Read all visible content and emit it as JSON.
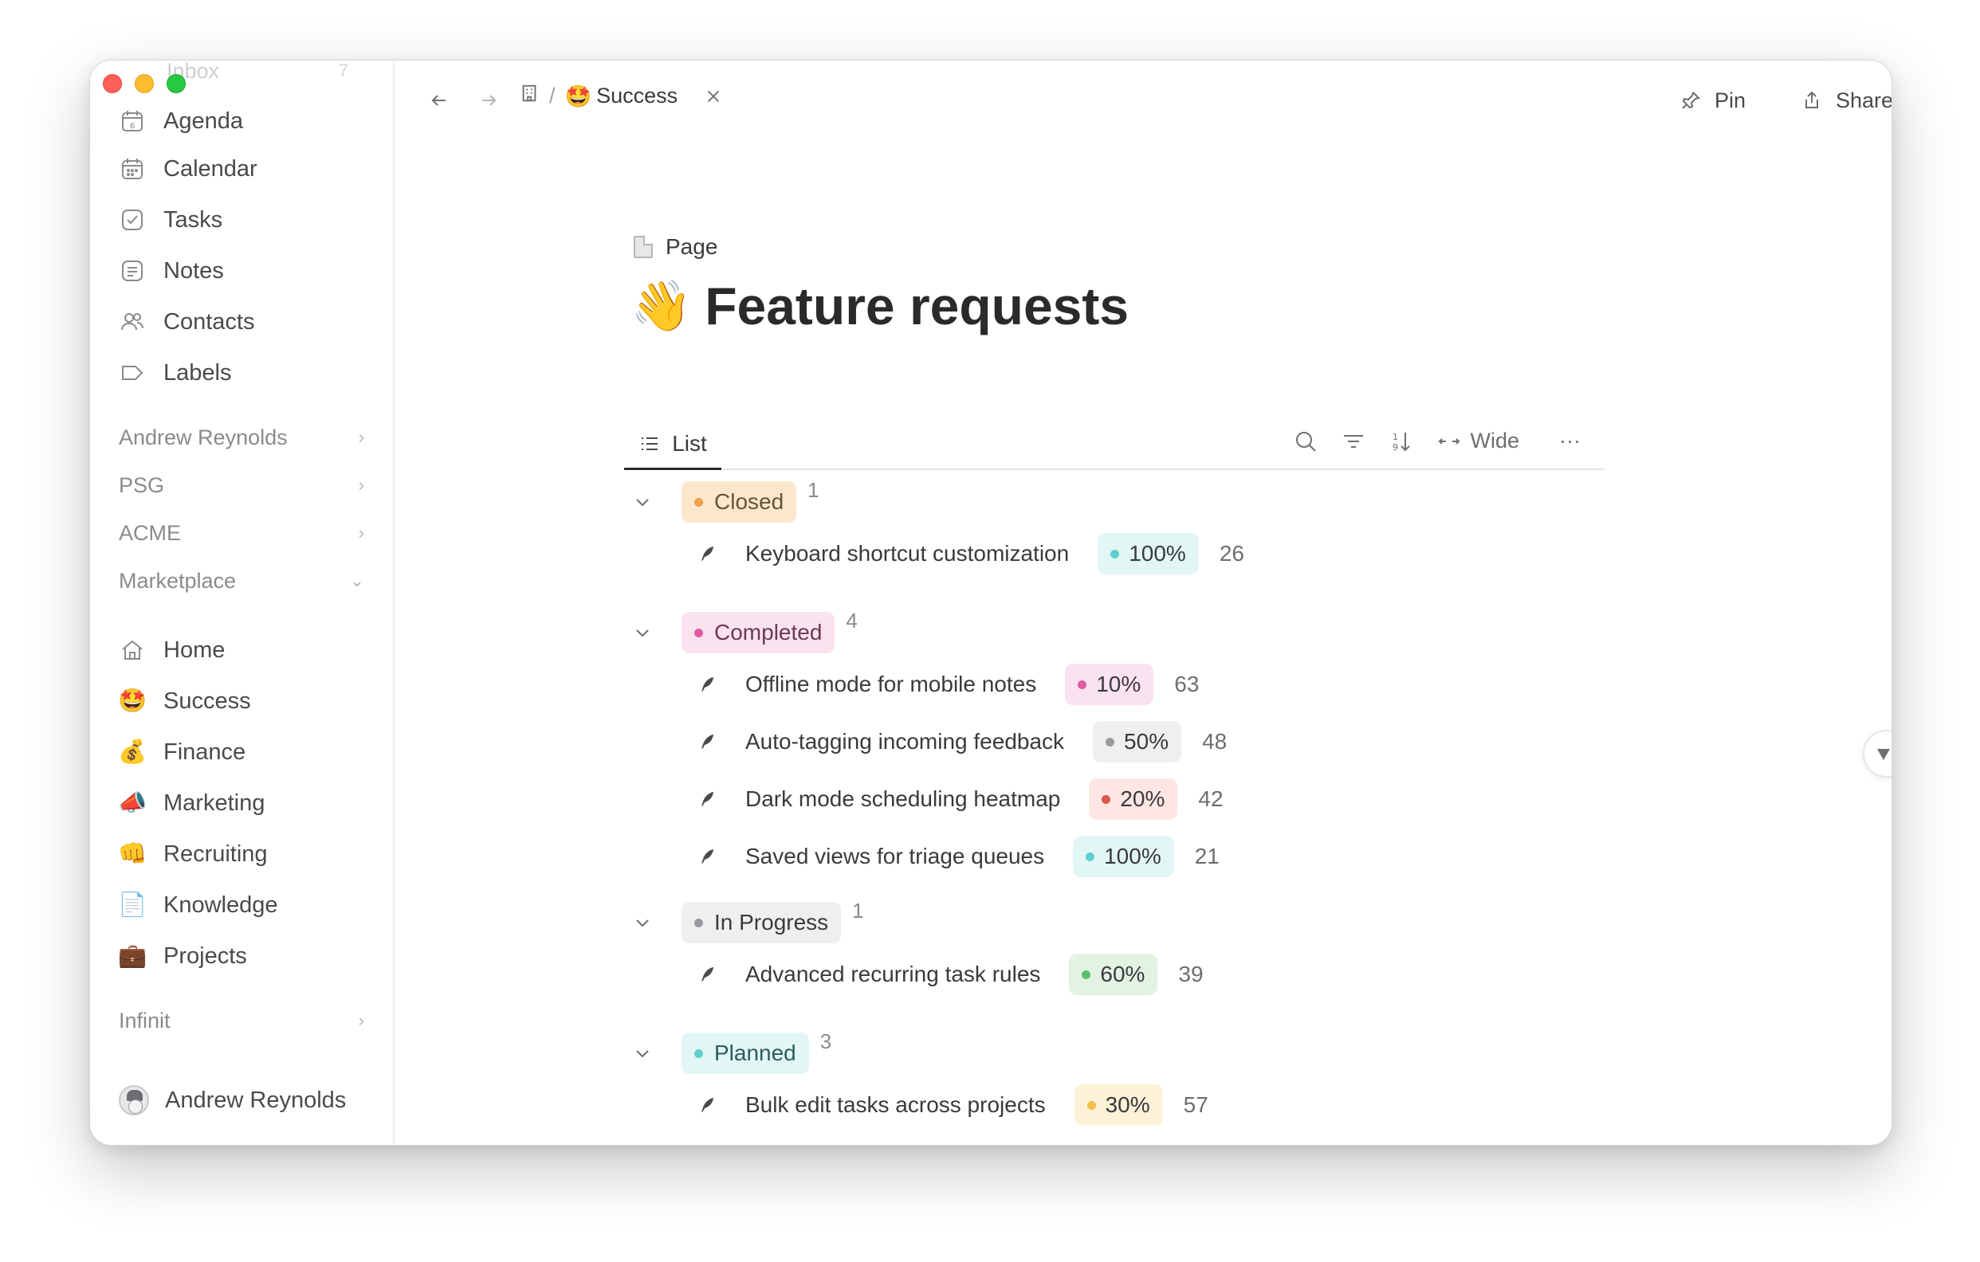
{
  "sidebar": {
    "ghost": {
      "label": "Inbox",
      "count": "7"
    },
    "nav": [
      {
        "label": "Agenda",
        "icon": "agenda-icon"
      },
      {
        "label": "Calendar",
        "icon": "calendar-icon"
      },
      {
        "label": "Tasks",
        "icon": "tasks-icon"
      },
      {
        "label": "Notes",
        "icon": "notes-icon"
      },
      {
        "label": "Contacts",
        "icon": "contacts-icon"
      },
      {
        "label": "Labels",
        "icon": "labels-icon"
      }
    ],
    "groups": [
      {
        "label": "Andrew Reynolds",
        "chev": "›"
      },
      {
        "label": "PSG",
        "chev": "›"
      },
      {
        "label": "ACME",
        "chev": "›"
      },
      {
        "label": "Marketplace",
        "chev": "⌄"
      }
    ],
    "marketplace": [
      {
        "label": "Home",
        "icon": "home-icon"
      },
      {
        "label": "Success",
        "icon": "🤩"
      },
      {
        "label": "Finance",
        "icon": "💰"
      },
      {
        "label": "Marketing",
        "icon": "📣"
      },
      {
        "label": "Recruiting",
        "icon": "👊"
      },
      {
        "label": "Knowledge",
        "icon": "📄"
      },
      {
        "label": "Projects",
        "icon": "💼"
      }
    ],
    "infinit": {
      "label": "Infinit",
      "chev": "›"
    },
    "user": {
      "name": "Andrew Reynolds"
    }
  },
  "topbar": {
    "crumb_emoji": "🤩",
    "crumb_label": "Success",
    "pin_label": "Pin",
    "share_label": "Share",
    "more_label": "···"
  },
  "page": {
    "type_label": "Page",
    "title_emoji": "👋",
    "title": "Feature requests"
  },
  "viewbar": {
    "tab_label": "List",
    "wide_label": "Wide",
    "more_label": "···"
  },
  "groups": [
    {
      "name": "Closed",
      "count": "1",
      "bg": "#fde7cc",
      "dot": "#f0a04b",
      "color": "#6b5238",
      "items": [
        {
          "title": "Keyboard shortcut customization",
          "pct": "100%",
          "num": "26",
          "bg": "#e3f6f6",
          "dot": "#5fcfd0"
        }
      ]
    },
    {
      "name": "Completed",
      "count": "4",
      "bg": "#fbe2ef",
      "dot": "#e05aa5",
      "color": "#6b3a55",
      "items": [
        {
          "title": "Offline mode for mobile notes",
          "pct": "10%",
          "num": "63",
          "bg": "#fbe2ef",
          "dot": "#e05aa5"
        },
        {
          "title": "Auto-tagging incoming feedback",
          "pct": "50%",
          "num": "48",
          "bg": "#efeff0",
          "dot": "#9a9a9e"
        },
        {
          "title": "Dark mode scheduling heatmap",
          "pct": "20%",
          "num": "42",
          "bg": "#fde6e4",
          "dot": "#e0574c"
        },
        {
          "title": "Saved views for triage queues",
          "pct": "100%",
          "num": "21",
          "bg": "#e3f6f6",
          "dot": "#5fcfd0"
        }
      ]
    },
    {
      "name": "In Progress",
      "count": "1",
      "bg": "#efeff0",
      "dot": "#9a9a9e",
      "color": "#3a3a3c",
      "items": [
        {
          "title": "Advanced recurring task rules",
          "pct": "60%",
          "num": "39",
          "bg": "#e2f3e4",
          "dot": "#5cbf6d"
        }
      ]
    },
    {
      "name": "Planned",
      "count": "3",
      "bg": "#e3f6f6",
      "dot": "#5fcfd0",
      "color": "#2f5c5c",
      "items": [
        {
          "title": "Bulk edit tasks across projects",
          "pct": "30%",
          "num": "57",
          "bg": "#fdf2d8",
          "dot": "#f2c04b"
        }
      ]
    }
  ]
}
